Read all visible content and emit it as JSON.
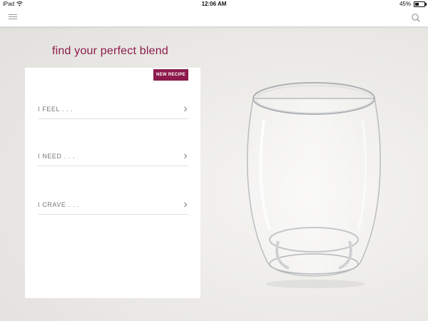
{
  "statusbar": {
    "device": "iPad",
    "time": "12:06 AM",
    "battery_text": "45%",
    "battery_level": 0.45
  },
  "navbar": {
    "menu_icon": "hamburger-menu-icon",
    "search_icon": "search-icon"
  },
  "page": {
    "headline": "find your perfect blend"
  },
  "card": {
    "new_recipe_label": "NEW RECIPE",
    "options": [
      {
        "label": "I FEEL . . ."
      },
      {
        "label": "I NEED . . ."
      },
      {
        "label": "I CRAVE . . ."
      }
    ]
  },
  "colors": {
    "accent": "#8c1a4d",
    "divider": "#e1e1e1",
    "label_text": "#777777"
  }
}
